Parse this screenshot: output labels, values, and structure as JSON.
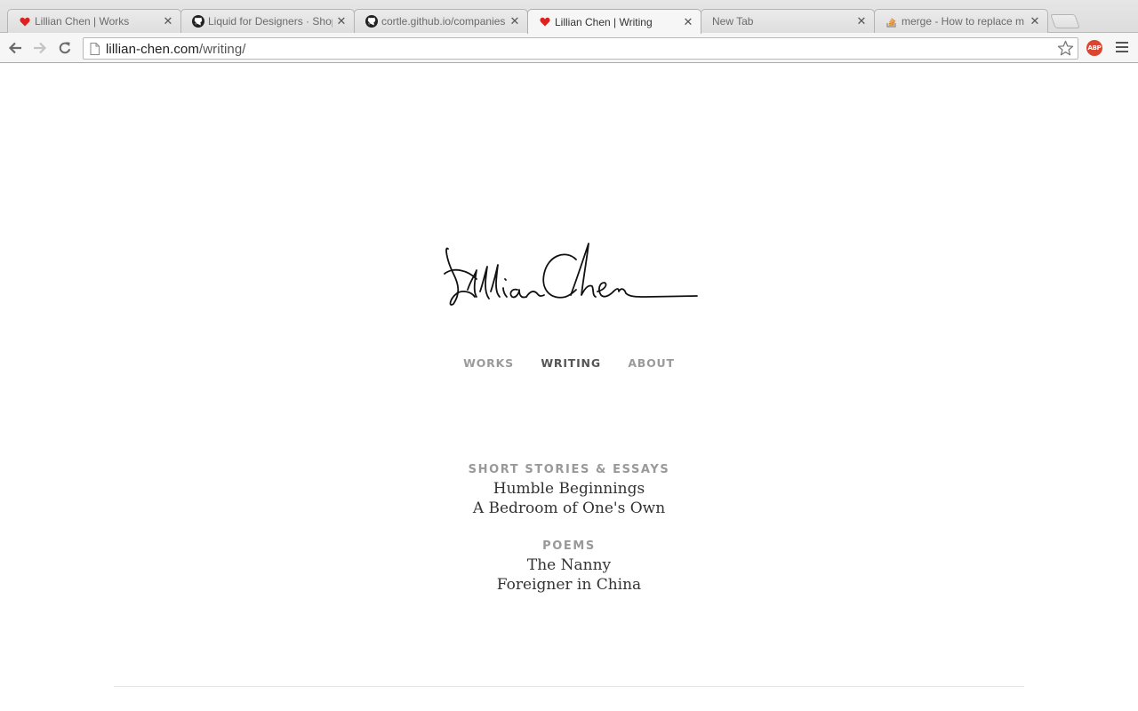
{
  "browser": {
    "tabs": [
      {
        "title": "Lillian Chen | Works",
        "icon": "heart-icon",
        "active": false
      },
      {
        "title": "Liquid for Designers · Shop",
        "icon": "github-icon",
        "active": false
      },
      {
        "title": "cortle.github.io/companies",
        "icon": "github-icon",
        "active": false
      },
      {
        "title": "Lillian Chen | Writing",
        "icon": "heart-icon",
        "active": true
      },
      {
        "title": "New Tab",
        "icon": "",
        "active": false
      },
      {
        "title": "merge - How to replace m",
        "icon": "stackoverflow-icon",
        "active": false
      }
    ],
    "url_host": "lillian-chen.com",
    "url_path": "/writing/",
    "extension_label": "ABP"
  },
  "site": {
    "signature_text": "Lillian Chen",
    "nav": [
      {
        "label": "WORKS",
        "active": false
      },
      {
        "label": "WRITING",
        "active": true
      },
      {
        "label": "ABOUT",
        "active": false
      }
    ],
    "sections": [
      {
        "heading": "SHORT STORIES & ESSAYS",
        "entries": [
          "Humble Beginnings",
          "A Bedroom of One's Own"
        ]
      },
      {
        "heading": "POEMS",
        "entries": [
          "The Nanny",
          "Foreigner in China"
        ]
      }
    ]
  },
  "colors": {
    "heart": "#e0201f",
    "nav_active": "#555555",
    "nav_inactive": "#9a9a9a",
    "heading": "#999999",
    "abp": "#d9452f"
  }
}
